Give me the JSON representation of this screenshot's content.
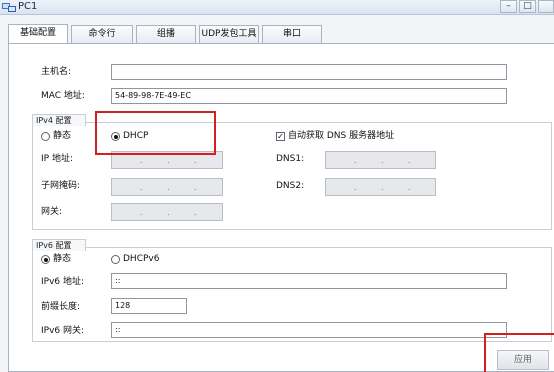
{
  "window": {
    "title": "PC1",
    "buttons": {
      "minimize": "–",
      "maximize": "□"
    }
  },
  "tabs": [
    {
      "label": "基础配置",
      "active": true
    },
    {
      "label": "命令行",
      "active": false
    },
    {
      "label": "组播",
      "active": false
    },
    {
      "label": "UDP发包工具",
      "active": false
    },
    {
      "label": "串口",
      "active": false
    }
  ],
  "basic": {
    "hostname_label": "主机名:",
    "hostname_value": "",
    "mac_label": "MAC 地址:",
    "mac_value": "54-89-98-7E-49-EC"
  },
  "ipv4": {
    "group_title": "IPv4 配置",
    "static_label": "静态",
    "dhcp_label": "DHCP",
    "selected": "DHCP",
    "auto_dns_label": "自动获取 DNS 服务器地址",
    "auto_dns_checked": true,
    "ip_label": "IP 地址:",
    "mask_label": "子网掩码:",
    "gateway_label": "网关:",
    "dns1_label": "DNS1:",
    "dns2_label": "DNS2:",
    "ip_separator": "."
  },
  "ipv6": {
    "group_title": "IPv6 配置",
    "static_label": "静态",
    "dhcpv6_label": "DHCPv6",
    "selected": "静态",
    "address_label": "IPv6 地址:",
    "address_value": "::",
    "prefix_label": "前缀长度:",
    "prefix_value": "128",
    "gateway_label": "IPv6 网关:",
    "gateway_value": "::"
  },
  "apply_label": "应用",
  "colors": {
    "highlight": "#d21f1f"
  }
}
